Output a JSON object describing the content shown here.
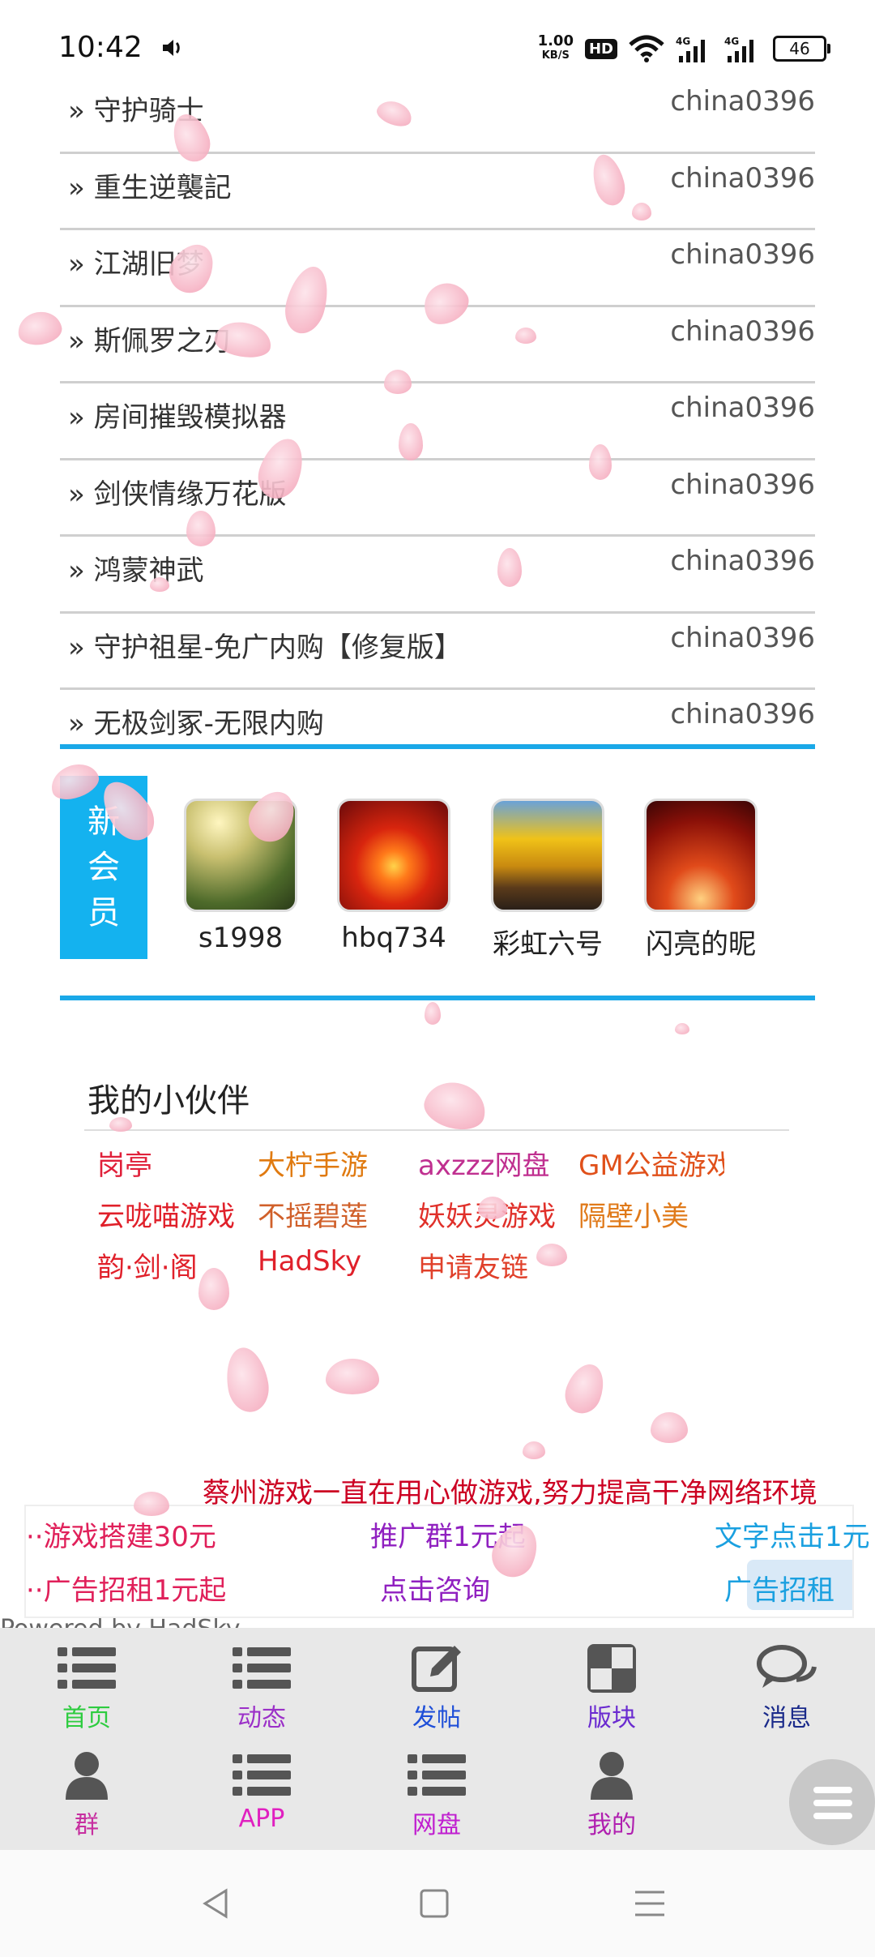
{
  "status_bar": {
    "time": "10:42",
    "net_speed_value": "1.00",
    "net_speed_unit": "KB/S",
    "hd_badge": "HD",
    "battery": "46"
  },
  "threads": [
    {
      "title": "» 守护骑士",
      "author": "china0396"
    },
    {
      "title": "» 重生逆襲記",
      "author": "china0396"
    },
    {
      "title": "» 江湖旧梦",
      "author": "china0396"
    },
    {
      "title": "» 斯佩罗之刃",
      "author": "china0396"
    },
    {
      "title": "» 房间摧毁模拟器",
      "author": "china0396"
    },
    {
      "title": "» 剑侠情缘万花版",
      "author": "china0396"
    },
    {
      "title": "» 鸿蒙神武",
      "author": "china0396"
    },
    {
      "title": "» 守护祖星-免广内购【修复版】",
      "author": "china0396"
    },
    {
      "title": "» 无极剑冢-无限内购",
      "author": "china0396"
    }
  ],
  "new_members": {
    "tag_chars": [
      "新",
      "会",
      "员"
    ],
    "members": [
      {
        "name": "s1998"
      },
      {
        "name": "hbq734"
      },
      {
        "name": "彩虹六号"
      },
      {
        "name": "闪亮的昵"
      }
    ]
  },
  "partners": {
    "title": "我的小伙伴",
    "links": [
      {
        "label": "岗亭"
      },
      {
        "label": "大柠手游"
      },
      {
        "label": "axzzz网盘"
      },
      {
        "label": "GM公益游戏"
      },
      {
        "label": "云咙喵游戏"
      },
      {
        "label": "不摇碧莲"
      },
      {
        "label": "妖妖灵游戏"
      },
      {
        "label": "隔壁小美"
      },
      {
        "label": "韵·剑·阁"
      },
      {
        "label": "HadSky"
      },
      {
        "label": "申请友链"
      }
    ]
  },
  "ads": {
    "marquee": "蔡州游戏一直在用心做游戏,努力提高干净网络环境",
    "items": [
      {
        "label": "··游戏搭建30元"
      },
      {
        "label": "推广群1元起"
      },
      {
        "label": "文字点击1元"
      },
      {
        "label": "··广告招租1元起"
      },
      {
        "label": "点击咨询"
      },
      {
        "label": "广告招租"
      }
    ],
    "powered_by": "Powered by HadSky"
  },
  "bottom_nav": {
    "items": [
      {
        "label": "首页",
        "icon": "list-icon",
        "color": "#2ecc40"
      },
      {
        "label": "动态",
        "icon": "list-icon",
        "color": "#9b30c8"
      },
      {
        "label": "发帖",
        "icon": "edit-icon",
        "color": "#1f4fd8"
      },
      {
        "label": "版块",
        "icon": "grid-icon",
        "color": "#6a2ad0"
      },
      {
        "label": "消息",
        "icon": "chat-icon",
        "color": "#1a2a8a"
      },
      {
        "label": "群",
        "icon": "user-icon",
        "color": "#c72fa0"
      },
      {
        "label": "APP",
        "icon": "list-icon",
        "color": "#e020c0"
      },
      {
        "label": "网盘",
        "icon": "list-icon",
        "color": "#c020d0"
      },
      {
        "label": "我的",
        "icon": "user-icon",
        "color": "#b020b0"
      }
    ]
  }
}
